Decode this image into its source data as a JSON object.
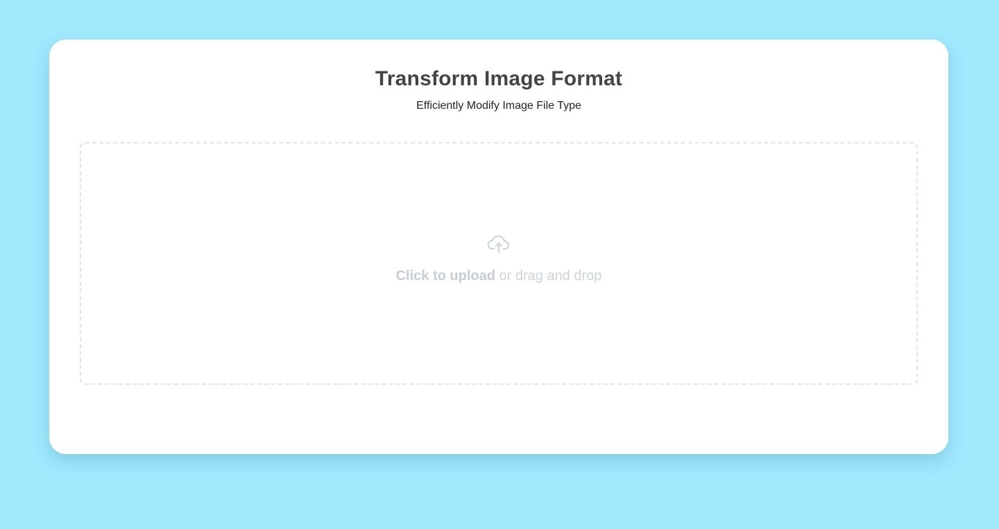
{
  "page": {
    "background_color": "#a1e9fd",
    "card_color": "#ffffff"
  },
  "header": {
    "title": "Transform Image Format",
    "subtitle": "Efficiently Modify Image File Type"
  },
  "dropzone": {
    "icon": "cloud-upload-icon",
    "action_label": "Click to upload",
    "secondary_label": "or drag and drop",
    "text_color": "#cfd3dc",
    "border_color": "#e2e4e8"
  }
}
